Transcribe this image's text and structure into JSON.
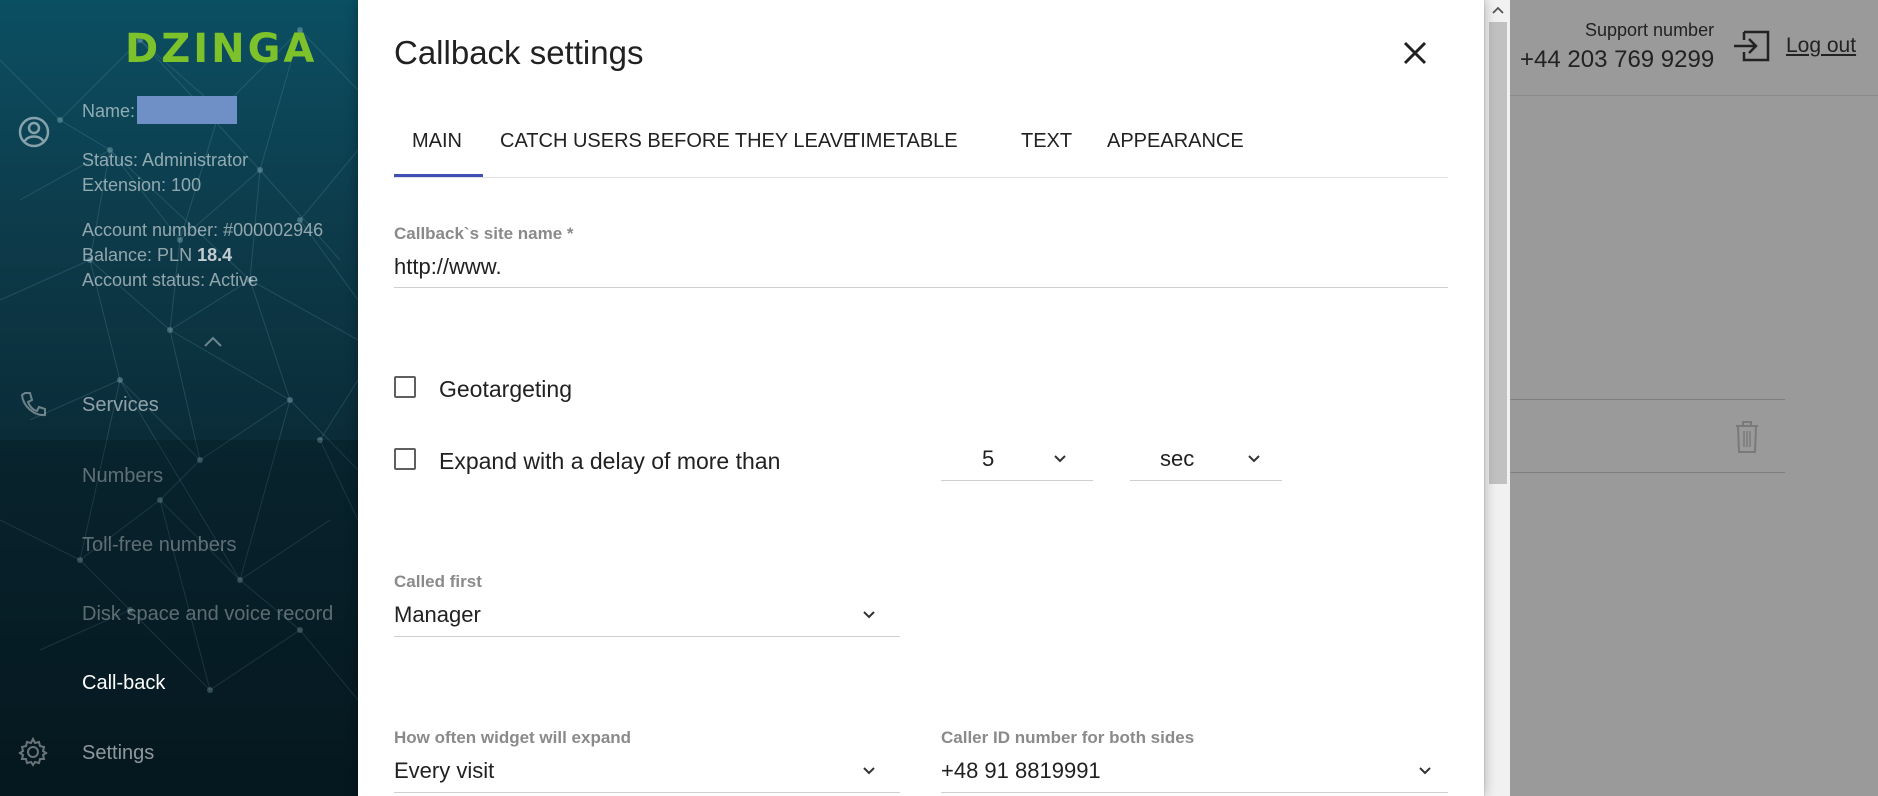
{
  "sidebar": {
    "logo": "DZINGA",
    "user": {
      "name_label": "Name:",
      "status": "Status: Administrator",
      "extension": "Extension: 100",
      "account_number": "Account number: #000002946",
      "balance_label": "Balance: PLN ",
      "balance_value": "18.4",
      "account_status": "Account status: Active"
    },
    "nav": {
      "services": "Services",
      "numbers": "Numbers",
      "toll_free": "Toll-free numbers",
      "disk_space": "Disk space and voice record",
      "callback": "Call-back",
      "settings": "Settings"
    }
  },
  "header": {
    "support_label": "Support number",
    "support_number": "+44 203 769 9299",
    "logout": "Log out"
  },
  "dialog": {
    "title": "Callback settings",
    "tabs": [
      "MAIN",
      "CATCH USERS BEFORE THEY LEAVE",
      "TIMETABLE",
      "TEXT",
      "APPEARANCE"
    ],
    "active_tab": "MAIN",
    "site_name": {
      "label": "Callback`s site name *",
      "value": "http://www."
    },
    "geotargeting": {
      "label": "Geotargeting",
      "checked": false
    },
    "expand_delay": {
      "label": "Expand with a delay of more than",
      "checked": false,
      "amount": "5",
      "unit": "sec"
    },
    "called_first": {
      "label": "Called first",
      "value": "Manager"
    },
    "how_often": {
      "label": "How often widget will expand",
      "value": "Every visit"
    },
    "caller_id": {
      "label": "Caller ID number for both sides",
      "value": "+48 91 8819991"
    }
  },
  "colors": {
    "logo_green": "#7dc22b",
    "tab_accent": "#3f51b5",
    "sidebar_dark": "#0a2c38"
  }
}
